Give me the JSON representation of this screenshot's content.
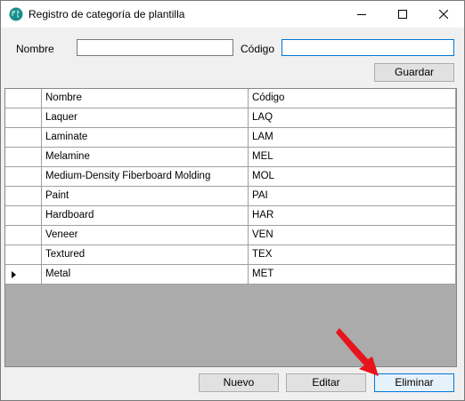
{
  "window": {
    "title": "Registro de categoría de plantilla",
    "controls": {
      "minimize": "minimize",
      "maximize": "maximize",
      "close": "close"
    }
  },
  "form": {
    "nombre_label": "Nombre",
    "nombre_value": "",
    "codigo_label": "Código",
    "codigo_value": "",
    "save_label": "Guardar"
  },
  "grid": {
    "columns": [
      "Nombre",
      "Código"
    ],
    "rows": [
      {
        "nombre": "Laquer",
        "codigo": "LAQ"
      },
      {
        "nombre": "Laminate",
        "codigo": "LAM"
      },
      {
        "nombre": "Melamine",
        "codigo": "MEL"
      },
      {
        "nombre": "Medium-Density Fiberboard Molding",
        "codigo": "MOL"
      },
      {
        "nombre": "Paint",
        "codigo": "PAI"
      },
      {
        "nombre": "Hardboard",
        "codigo": "HAR"
      },
      {
        "nombre": "Veneer",
        "codigo": "VEN"
      },
      {
        "nombre": "Textured",
        "codigo": "TEX"
      },
      {
        "nombre": "Metal",
        "codigo": "MET"
      }
    ],
    "current_row_index": 8
  },
  "actions": {
    "new_label": "Nuevo",
    "edit_label": "Editar",
    "delete_label": "Eliminar"
  },
  "colors": {
    "accent": "#0078d7",
    "annotation_arrow": "#e8141c",
    "grid_background": "#ababab"
  },
  "icons": {
    "app": "globe-icon",
    "annotation": "red-arrow-icon"
  }
}
